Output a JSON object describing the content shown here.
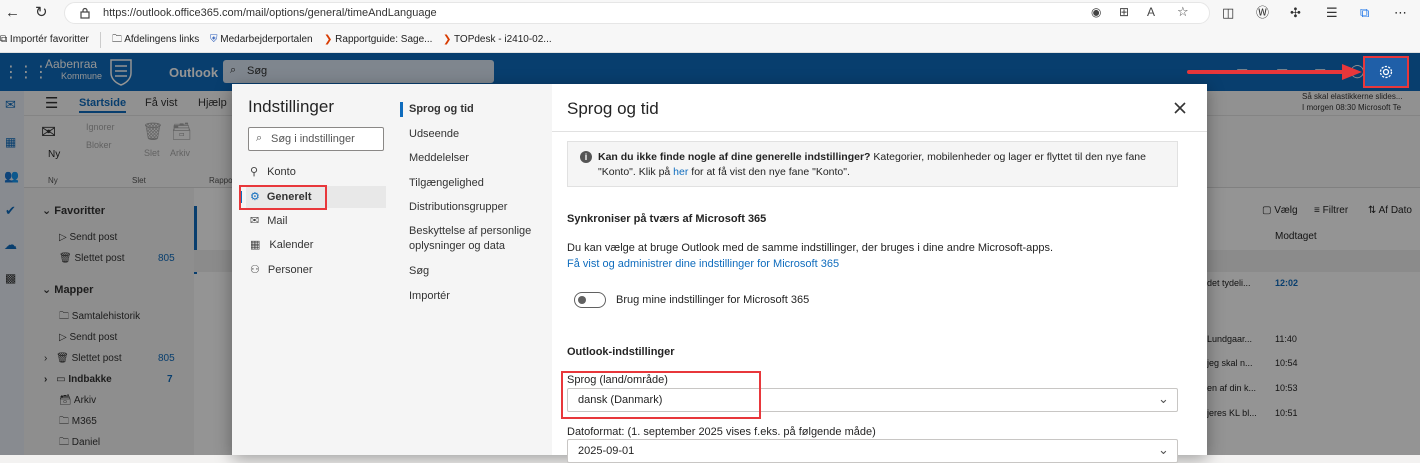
{
  "browser": {
    "url": "https://outlook.office365.com/mail/options/general/timeAndLanguage",
    "bookmarks": [
      "Importér favoritter",
      "Afdelingens links",
      "Medarbejderportalen",
      "Rapportguide: Sage...",
      "TOPdesk - i2410-02..."
    ]
  },
  "suite": {
    "org_name": "Aabenraa",
    "org_sub": "Kommune",
    "app_name": "Outlook",
    "search_placeholder": "Søg",
    "notification_title": "Så skal elastikkerne slides...",
    "notification_sub": "I morgen 08:30 Microsoft Te"
  },
  "ribbon": {
    "tabs": [
      "Startside",
      "Få vist",
      "Hjælp"
    ],
    "new_label": "Ny",
    "ignore_label": "Ignorer",
    "block_label": "Bloker",
    "delete_label": "Slet",
    "archive_label": "Arkiv",
    "group_new": "Ny",
    "group_delete": "Slet",
    "group_report": "Rappo"
  },
  "folders": {
    "favorites_header": "Favoritter",
    "favorites": [
      {
        "name": "Sendt post",
        "count": ""
      },
      {
        "name": "Slettet post",
        "count": "805"
      }
    ],
    "folders_header": "Mapper",
    "items": [
      {
        "name": "Samtalehistorik",
        "count": ""
      },
      {
        "name": "Sendt post",
        "count": ""
      },
      {
        "name": "Slettet post",
        "count": "805"
      },
      {
        "name": "Indbakke",
        "count": "7"
      },
      {
        "name": "Arkiv",
        "count": ""
      },
      {
        "name": "M365",
        "count": ""
      },
      {
        "name": "Daniel",
        "count": ""
      }
    ]
  },
  "message_list": {
    "select_label": "Vælg",
    "filter_label": "Filtrer",
    "sort_label": "Af Dato",
    "received_header": "Modtaget",
    "rows": [
      {
        "snippet": "det tydeli...",
        "time": "12:02"
      },
      {
        "snippet": "Lundgaar...",
        "time": "11:40"
      },
      {
        "snippet": "jeg skal n...",
        "time": "10:54"
      },
      {
        "snippet": "en af din k...",
        "time": "10:53"
      },
      {
        "snippet": "jeres KL bl...",
        "time": "10:51"
      }
    ]
  },
  "settings": {
    "title": "Indstillinger",
    "search_placeholder": "Søg i indstillinger",
    "nav": [
      "Konto",
      "Generelt",
      "Mail",
      "Kalender",
      "Personer"
    ],
    "subnav": [
      "Sprog og tid",
      "Udseende",
      "Meddelelser",
      "Tilgængelighed",
      "Distributionsgrupper",
      "Beskyttelse af personlige oplysninger og data",
      "Søg",
      "Importér"
    ],
    "page_title": "Sprog og tid",
    "info_bold": "Kan du ikke finde nogle af dine generelle indstillinger?",
    "info_text": " Kategorier, mobilenheder og lager er flyttet til den nye fane \"Konto\". Klik på ",
    "info_link": "her",
    "info_tail": " for at få vist den nye fane \"Konto\".",
    "sync_header": "Synkroniser på tværs af Microsoft 365",
    "sync_desc": "Du kan vælge at bruge Outlook med de samme indstillinger, der bruges i dine andre Microsoft-apps.",
    "sync_link": "Få vist og administrer dine indstillinger for Microsoft 365",
    "toggle_label": "Brug mine indstillinger for Microsoft 365",
    "toggle_on": false,
    "outlook_header": "Outlook-indstillinger",
    "language_label": "Sprog (land/område)",
    "language_value": "dansk (Danmark)",
    "dateformat_label": "Datoformat: (1. september 2025 vises f.eks. på følgende måde)",
    "dateformat_value": "2025-09-01"
  },
  "colors": {
    "brand": "#0f6cbd",
    "highlight": "#e8373b",
    "link": "#0f6cbd"
  }
}
